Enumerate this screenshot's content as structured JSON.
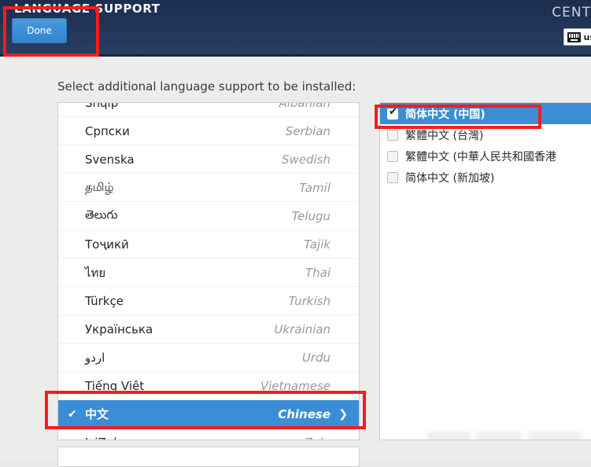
{
  "header": {
    "title": "LANGUAGE SUPPORT",
    "brand": "CENT",
    "done_label": "Done",
    "keyboard_layout": "us"
  },
  "main": {
    "instruction": "Select additional language support to be installed:"
  },
  "language_list": [
    {
      "native": "Shqip",
      "english": "Albanian",
      "selected": false
    },
    {
      "native": "Српски",
      "english": "Serbian",
      "selected": false
    },
    {
      "native": "Svenska",
      "english": "Swedish",
      "selected": false
    },
    {
      "native": "தமிழ்",
      "english": "Tamil",
      "selected": false
    },
    {
      "native": "తెలుగు",
      "english": "Telugu",
      "selected": false
    },
    {
      "native": "Тоҷикӣ",
      "english": "Tajik",
      "selected": false
    },
    {
      "native": "ไทย",
      "english": "Thai",
      "selected": false
    },
    {
      "native": "Türkçe",
      "english": "Turkish",
      "selected": false
    },
    {
      "native": "Українська",
      "english": "Ukrainian",
      "selected": false
    },
    {
      "native": "اردو",
      "english": "Urdu",
      "selected": false
    },
    {
      "native": "Tiếng Việt",
      "english": "Vietnamese",
      "selected": false
    },
    {
      "native": "中文",
      "english": "Chinese",
      "selected": true
    },
    {
      "native": "IsiZulu",
      "english": "Zulu",
      "selected": false
    }
  ],
  "locale_list": [
    {
      "label": "简体中文 (中国)",
      "checked": true
    },
    {
      "label": "繁體中文 (台灣)",
      "checked": false
    },
    {
      "label": "繁體中文 (中華人民共和國香港",
      "checked": false
    },
    {
      "label": "简体中文 (新加坡)",
      "checked": false
    }
  ],
  "icons": {
    "check_mark": "✔",
    "chevron_right": "❯"
  },
  "annotations": [
    {
      "name": "done-button-highlight"
    },
    {
      "name": "chinese-row-highlight"
    },
    {
      "name": "simplified-chinese-highlight"
    }
  ],
  "colors": {
    "header_bg": "#223558",
    "accent_blue": "#3b8ed6",
    "annotation_red": "#f41d1d",
    "page_bg": "#ececea"
  }
}
